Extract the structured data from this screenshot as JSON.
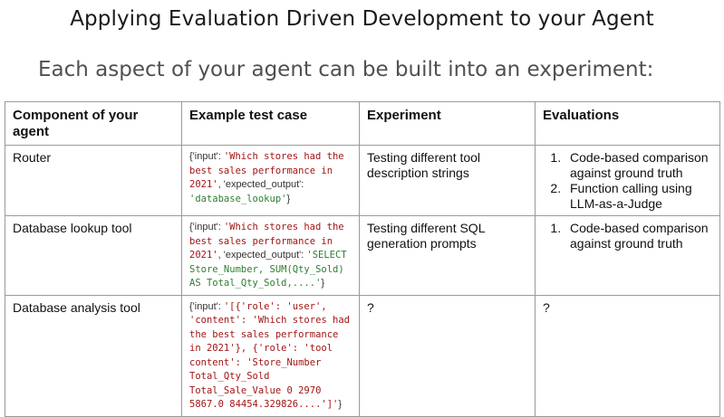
{
  "title": "Applying Evaluation Driven Development to your Agent",
  "subtitle": "Each aspect of your agent can be built into an experiment:",
  "table": {
    "headers": [
      "Component of your agent",
      "Example test case",
      "Experiment",
      "Evaluations"
    ],
    "rows": [
      {
        "component": "Router",
        "test_case": {
          "t1": "{'input': ",
          "t2": "'Which stores had the best sales performance in 2021'",
          "t3": ", 'expected_output': ",
          "t4": "'database_lookup'",
          "t5": "}"
        },
        "experiment": "Testing different tool description strings",
        "evaluations": [
          "Code-based comparison against ground truth",
          "Function calling using LLM-as-a-Judge"
        ]
      },
      {
        "component": "Database lookup tool",
        "test_case": {
          "t1": "{'input': ",
          "t2": "'Which stores had the best sales performance in 2021'",
          "t3": ", 'expected_output': ",
          "t4": "'SELECT Store_Number, SUM(Qty_Sold) AS Total_Qty_Sold,....'",
          "t5": "}"
        },
        "experiment": "Testing different SQL generation prompts",
        "evaluations": [
          "Code-based comparison against ground truth"
        ]
      },
      {
        "component": "Database analysis tool",
        "test_case": {
          "t1": "{'input': ",
          "t2": "'[{'role': 'user', 'content': 'Which stores had the best sales performance in 2021'}, {'role': 'tool content': 'Store_Number Total_Qty_Sold Total_Sale_Value 0 2970 5867.0 84454.329826....']'",
          "t3": "}"
        },
        "experiment": "?",
        "evaluations_text": "?"
      }
    ]
  }
}
